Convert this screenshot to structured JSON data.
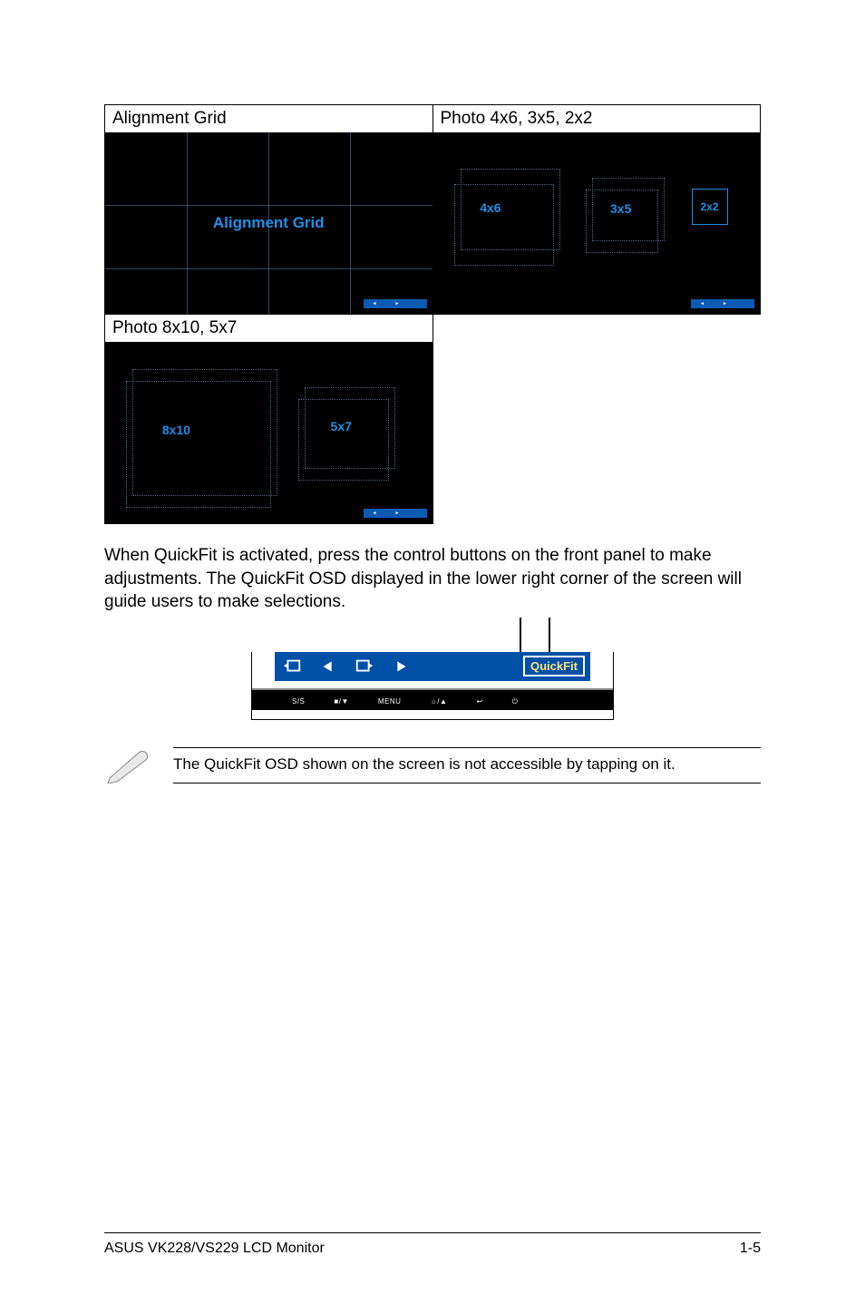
{
  "table": {
    "cells": [
      {
        "header": "Alignment Grid",
        "screen_label": "Alignment Grid"
      },
      {
        "header": "Photo 4x6, 3x5, 2x2",
        "boxes": [
          "4x6",
          "3x5",
          "2x2"
        ]
      },
      {
        "header": "Photo 8x10, 5x7",
        "boxes": [
          "8x10",
          "5x7"
        ]
      }
    ]
  },
  "paragraph": "When QuickFit is activated, press the control buttons on the front panel to make adjustments. The QuickFit OSD displayed in the lower right corner of the screen will guide users to make selections.",
  "osd": {
    "icons": [
      "enter-icon",
      "left-arrow-icon",
      "exit-icon",
      "right-arrow-icon"
    ],
    "label": "QuickFit",
    "bezel": [
      "S/S",
      "■/▼",
      "MENU",
      "☼/▲",
      "↩",
      "⏻"
    ]
  },
  "note": "The QuickFit OSD shown on the screen is not accessible by tapping on it.",
  "footer": {
    "left": "ASUS VK228/VS229 LCD Monitor",
    "right": "1-5"
  }
}
